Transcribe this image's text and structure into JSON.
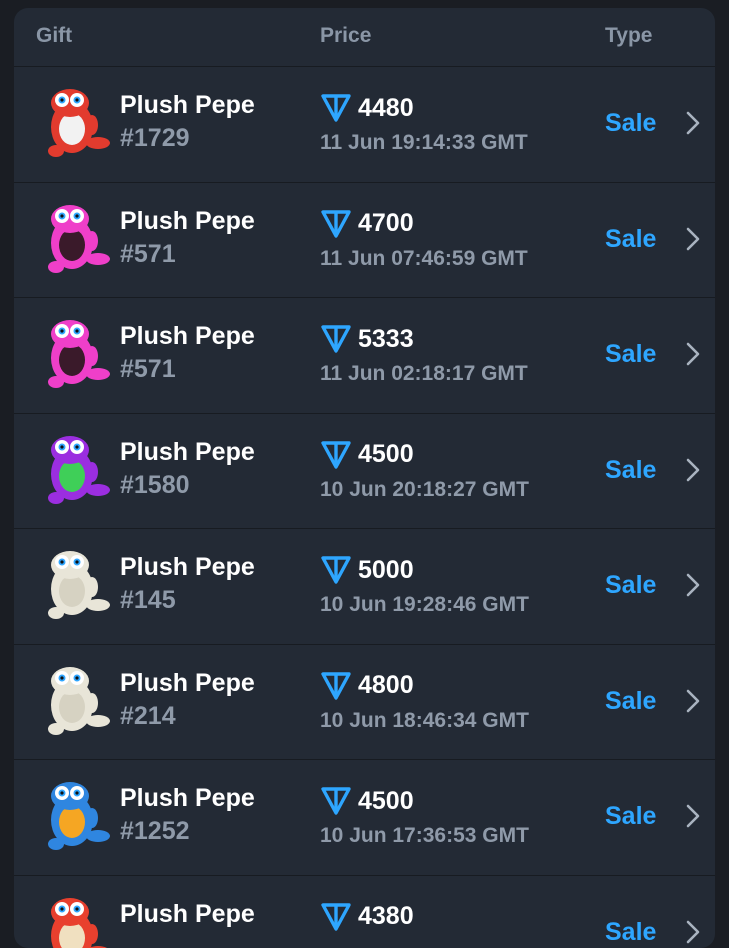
{
  "header": {
    "gift": "Gift",
    "price": "Price",
    "type": "Type"
  },
  "rows": [
    {
      "name": "Plush Pepe",
      "number": "#1729",
      "price": "4480",
      "time": "11 Jun 19:14:33 GMT",
      "type": "Sale",
      "color": "#e23b2e",
      "belly": "#f2f2f2"
    },
    {
      "name": "Plush Pepe",
      "number": "#571",
      "price": "4700",
      "time": "11 Jun 07:46:59 GMT",
      "type": "Sale",
      "color": "#ef3fc9",
      "belly": "#3a1a2a"
    },
    {
      "name": "Plush Pepe",
      "number": "#571",
      "price": "5333",
      "time": "11 Jun 02:18:17 GMT",
      "type": "Sale",
      "color": "#ef3fc9",
      "belly": "#3a1a2a"
    },
    {
      "name": "Plush Pepe",
      "number": "#1580",
      "price": "4500",
      "time": "10 Jun 20:18:27 GMT",
      "type": "Sale",
      "color": "#9b2ee0",
      "belly": "#3fcf58"
    },
    {
      "name": "Plush Pepe",
      "number": "#145",
      "price": "5000",
      "time": "10 Jun 19:28:46 GMT",
      "type": "Sale",
      "color": "#e8e5d8",
      "belly": "#d6d2c2"
    },
    {
      "name": "Plush Pepe",
      "number": "#214",
      "price": "4800",
      "time": "10 Jun 18:46:34 GMT",
      "type": "Sale",
      "color": "#e8e5d8",
      "belly": "#d6d2c2"
    },
    {
      "name": "Plush Pepe",
      "number": "#1252",
      "price": "4500",
      "time": "10 Jun 17:36:53 GMT",
      "type": "Sale",
      "color": "#2f86e0",
      "belly": "#f5a623"
    },
    {
      "name": "Plush Pepe",
      "number": "",
      "price": "4380",
      "time": "",
      "type": "Sale",
      "color": "#e8402e",
      "belly": "#f0e0c0"
    }
  ],
  "colors": {
    "accent": "#2ea6ff",
    "ton": "#2ea6ff",
    "background": "#232a35"
  }
}
